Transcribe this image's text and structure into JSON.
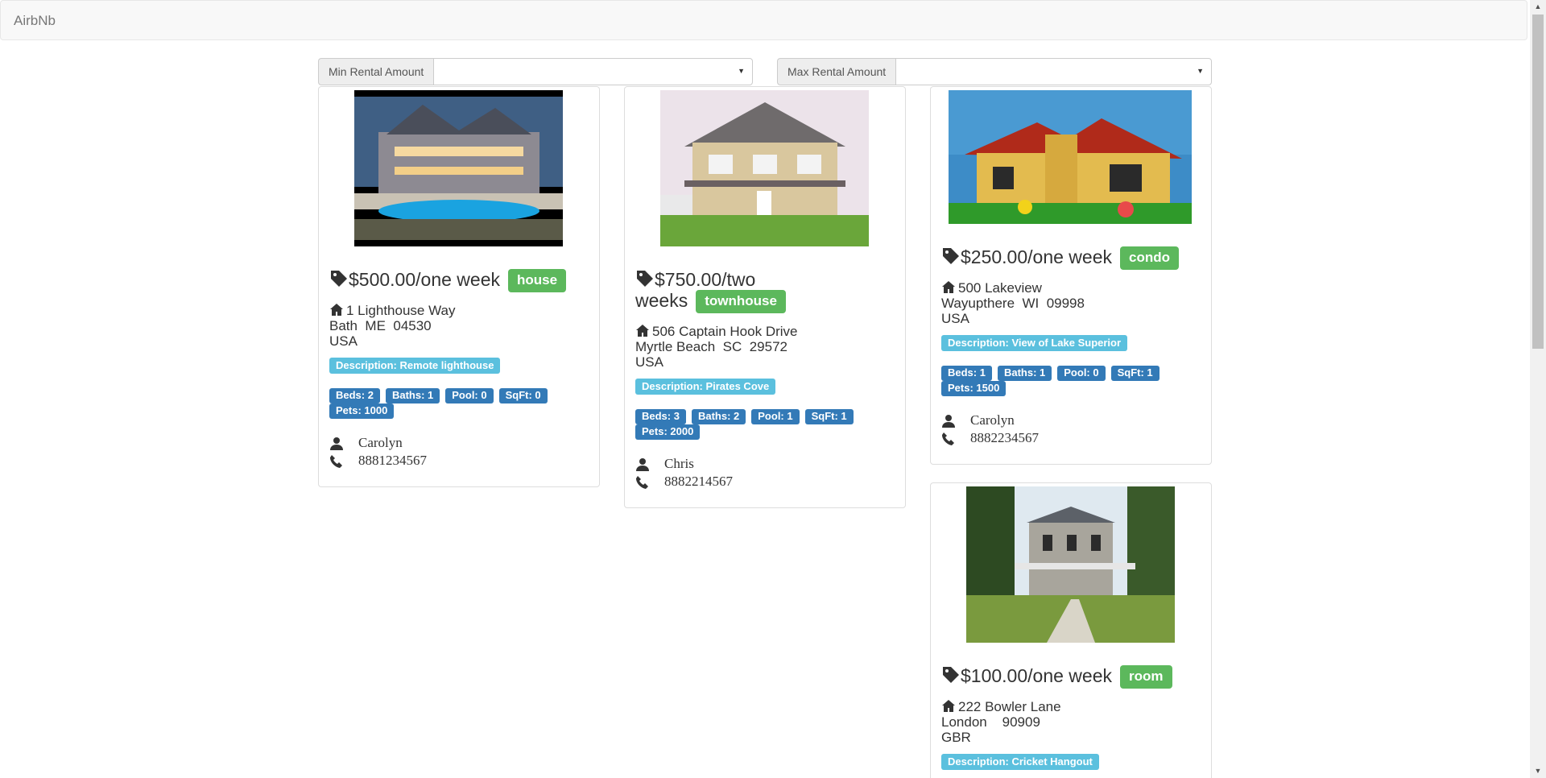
{
  "navbar": {
    "brand": "AirbNb"
  },
  "filters": {
    "min_label": "Min Rental Amount",
    "min_value": "",
    "max_label": "Max Rental Amount",
    "max_value": ""
  },
  "listings": [
    {
      "price": "$500.00/one week",
      "type": "house",
      "street": "1 Lighthouse Way",
      "city_line": "Bath  ME  04530",
      "country": "USA",
      "description": "Description: Remote lighthouse",
      "beds": "Beds: 2",
      "baths": "Baths: 1",
      "pool": "Pool: 0",
      "sqft": "SqFt: 0",
      "pets": "Pets: 1000",
      "owner": "Carolyn",
      "phone": "8881234567"
    },
    {
      "price_line1": "$750.00/two",
      "price_line2": "weeks",
      "type": "townhouse",
      "street": "506 Captain Hook Drive",
      "city_line": "Myrtle Beach  SC  29572",
      "country": "USA",
      "description": "Description: Pirates Cove",
      "beds": "Beds: 3",
      "baths": "Baths: 2",
      "pool": "Pool: 1",
      "sqft": "SqFt: 1",
      "pets": "Pets: 2000",
      "owner": "Chris",
      "phone": "8882214567"
    },
    {
      "price": "$250.00/one week",
      "type": "condo",
      "street": "500 Lakeview",
      "city_line": "Wayupthere  WI  09998",
      "country": "USA",
      "description": "Description: View of Lake Superior",
      "beds": "Beds: 1",
      "baths": "Baths: 1",
      "pool": "Pool: 0",
      "sqft": "SqFt: 1",
      "pets": "Pets: 1500",
      "owner": "Carolyn",
      "phone": "8882234567"
    },
    {
      "price": "$100.00/one week",
      "type": "room",
      "street": "222 Bowler Lane",
      "city_line": "London    90909",
      "country": "GBR",
      "description": "Description: Cricket Hangout"
    }
  ],
  "colors": {
    "type_badge": "#5cb85c",
    "description_badge": "#5bc0de",
    "stat_badge": "#337ab7"
  },
  "icons": [
    "tag-icon",
    "home-icon",
    "user-icon",
    "phone-icon",
    "chevron-down-icon"
  ]
}
